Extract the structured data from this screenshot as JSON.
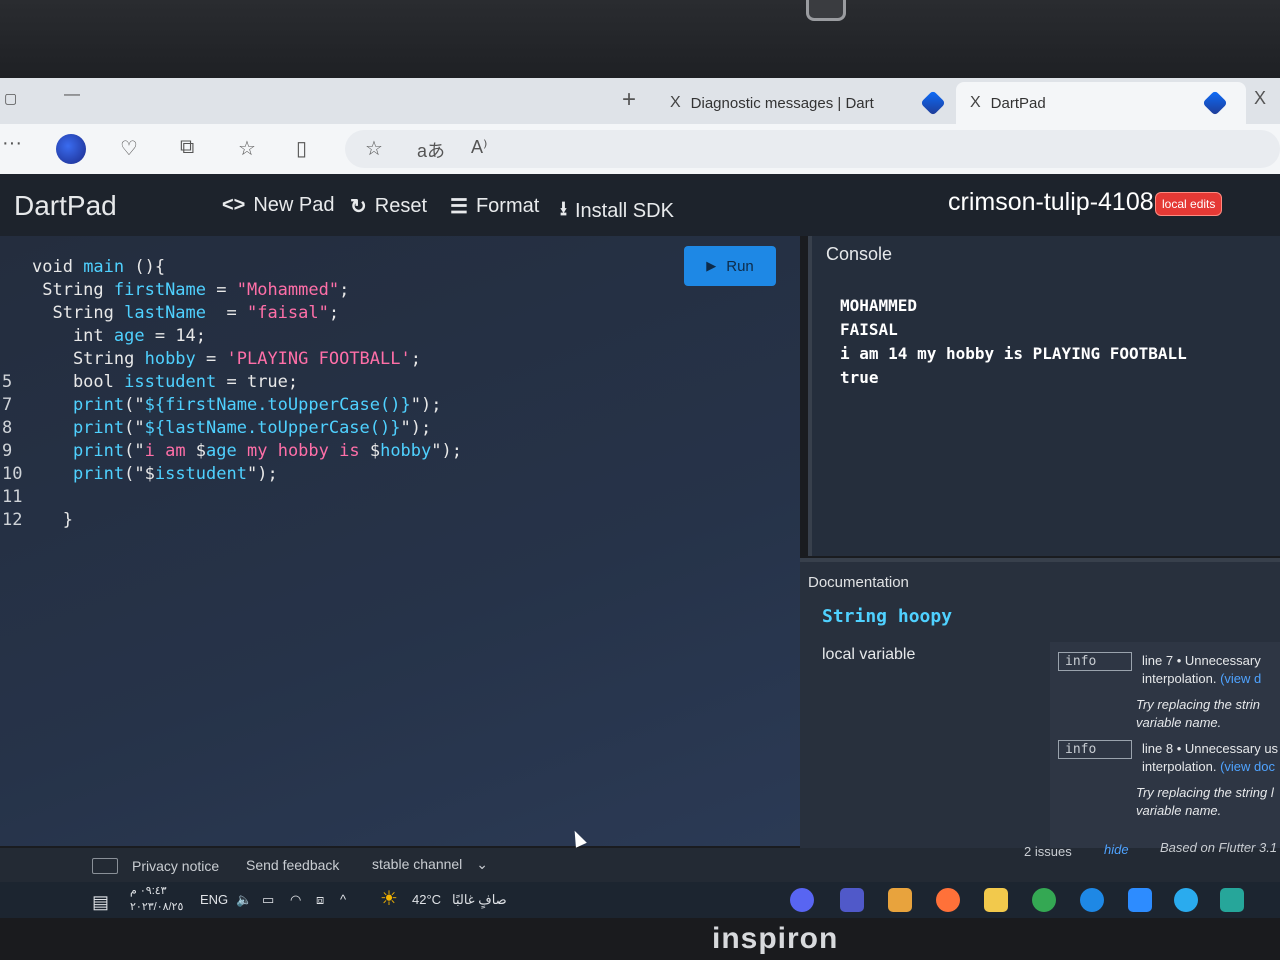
{
  "browser": {
    "tabs": [
      {
        "title": "Diagnostic messages | Dart"
      },
      {
        "title": "DartPad"
      }
    ],
    "new_tab": "+",
    "close": "X",
    "toolbar_icons": [
      "more-icon",
      "copilot-icon",
      "health-icon",
      "collections-icon",
      "favorites-list-icon",
      "split-view-icon",
      "favorite-star-icon",
      "translate-icon",
      "read-aloud-icon"
    ],
    "translate_glyph": "aあ",
    "read_aloud_glyph": "A⁾"
  },
  "app": {
    "logo": "DartPad",
    "actions": {
      "new_pad": "New Pad",
      "reset": "Reset",
      "format": "Format",
      "install_sdk": "Install SDK"
    },
    "pad_name": "crimson-tulip-4108",
    "badge": "local edits",
    "run_label": "Run"
  },
  "editor": {
    "lines": [
      {
        "n": "",
        "segs": [
          [
            "kw",
            "void "
          ],
          [
            "vr",
            "main"
          ],
          [
            "kw",
            " (){"
          ]
        ]
      },
      {
        "n": "",
        "segs": [
          [
            "kw",
            " String "
          ],
          [
            "vr",
            "firstName"
          ],
          [
            "kw",
            " = "
          ],
          [
            "st",
            "\"Mohammed\""
          ],
          [
            "kw",
            ";"
          ]
        ]
      },
      {
        "n": "",
        "segs": [
          [
            "kw",
            "  String "
          ],
          [
            "vr",
            "lastName"
          ],
          [
            "kw",
            "  = "
          ],
          [
            "st",
            "\"faisal\""
          ],
          [
            "kw",
            ";"
          ]
        ]
      },
      {
        "n": "",
        "segs": [
          [
            "kw",
            "    int "
          ],
          [
            "vr",
            "age"
          ],
          [
            "kw",
            " = 14;"
          ]
        ]
      },
      {
        "n": "",
        "segs": [
          [
            "kw",
            "    String "
          ],
          [
            "vr",
            "hobby"
          ],
          [
            "kw",
            " = "
          ],
          [
            "st",
            "'PLAYING FOOTBALL'"
          ],
          [
            "kw",
            ";"
          ]
        ]
      },
      {
        "n": "5",
        "segs": [
          [
            "kw",
            "    bool "
          ],
          [
            "vr",
            "isstudent"
          ],
          [
            "kw",
            " = true;"
          ]
        ]
      },
      {
        "n": "7",
        "segs": [
          [
            "pr",
            "    print"
          ],
          [
            "kw",
            "(\""
          ],
          [
            "vr",
            "${firstName.toUpperCase()}"
          ],
          [
            "kw",
            "\");"
          ]
        ]
      },
      {
        "n": "8",
        "segs": [
          [
            "pr",
            "    print"
          ],
          [
            "kw",
            "(\""
          ],
          [
            "vr",
            "${lastName.toUpperCase()}"
          ],
          [
            "kw",
            "\");"
          ]
        ]
      },
      {
        "n": "9",
        "segs": [
          [
            "pr",
            "    print"
          ],
          [
            "kw",
            "(\""
          ],
          [
            "st",
            "i am "
          ],
          [
            "kw",
            "$"
          ],
          [
            "vr",
            "age"
          ],
          [
            "st",
            " my hobby is "
          ],
          [
            "kw",
            "$"
          ],
          [
            "vr",
            "hobby"
          ],
          [
            "kw",
            "\");"
          ]
        ]
      },
      {
        "n": "10",
        "segs": [
          [
            "pr",
            "    print"
          ],
          [
            "kw",
            "(\"$"
          ],
          [
            "vr",
            "isstudent"
          ],
          [
            "kw",
            "\");"
          ]
        ]
      },
      {
        "n": "11",
        "segs": []
      },
      {
        "n": "12",
        "segs": [
          [
            "kw",
            "   }"
          ]
        ]
      }
    ]
  },
  "console": {
    "title": "Console",
    "output": [
      "MOHAMMED",
      "FAISAL",
      "i am 14 my hobby is PLAYING FOOTBALL",
      "true"
    ]
  },
  "documentation": {
    "title": "Documentation",
    "sig_type": "String",
    "sig_name": "hoopy",
    "description": "local variable"
  },
  "issues": [
    {
      "badge": "info",
      "title": "line 7 • Unnecessary",
      "detail": "interpolation.",
      "link": "(view d",
      "hint": "Try replacing the strin variable name."
    },
    {
      "badge": "info",
      "title": "line 8 • Unnecessary us",
      "detail": "interpolation.",
      "link": "(view doc",
      "hint": "Try replacing the string l variable name."
    }
  ],
  "status": {
    "issue_count": "2 issues",
    "hide": "hide",
    "flutter": "Based on Flutter 3.1",
    "privacy": "Privacy notice",
    "feedback": "Send feedback",
    "channel": "stable channel"
  },
  "taskbar": {
    "time": "٠٩:٤٣ م",
    "date": "٢٠٢٣/٠٨/٢٥",
    "lang": "ENG",
    "temp": "42°C",
    "weather": "صافٍ غالبًا"
  },
  "device": {
    "brand": "inspiron"
  }
}
